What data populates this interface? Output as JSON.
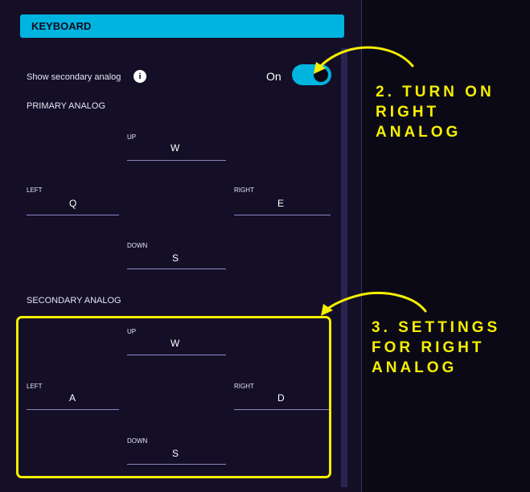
{
  "header": {
    "title": "KEYBOARD"
  },
  "secondary_toggle": {
    "label": "Show secondary analog",
    "state": "On"
  },
  "info_icon": "i",
  "primary": {
    "title": "PRIMARY ANALOG",
    "up": {
      "label": "UP",
      "value": "W"
    },
    "left": {
      "label": "LEFT",
      "value": "Q"
    },
    "right": {
      "label": "RIGHT",
      "value": "E"
    },
    "down": {
      "label": "DOWN",
      "value": "S"
    }
  },
  "secondary": {
    "title": "SECONDARY ANALOG",
    "up": {
      "label": "UP",
      "value": "W"
    },
    "left": {
      "label": "LEFT",
      "value": "A"
    },
    "right": {
      "label": "RIGHT",
      "value": "D"
    },
    "down": {
      "label": "DOWN",
      "value": "S"
    }
  },
  "annotations": {
    "step2": {
      "line1": "2. TURN ON",
      "line2": "RIGHT",
      "line3": "ANALOG"
    },
    "step3": {
      "line1": "3. SETTINGS",
      "line2": "FOR RIGHT",
      "line3": "ANALOG"
    }
  },
  "colors": {
    "accent": "#00b4e0",
    "annotation": "#f5ef00",
    "panel": "#140f27"
  }
}
